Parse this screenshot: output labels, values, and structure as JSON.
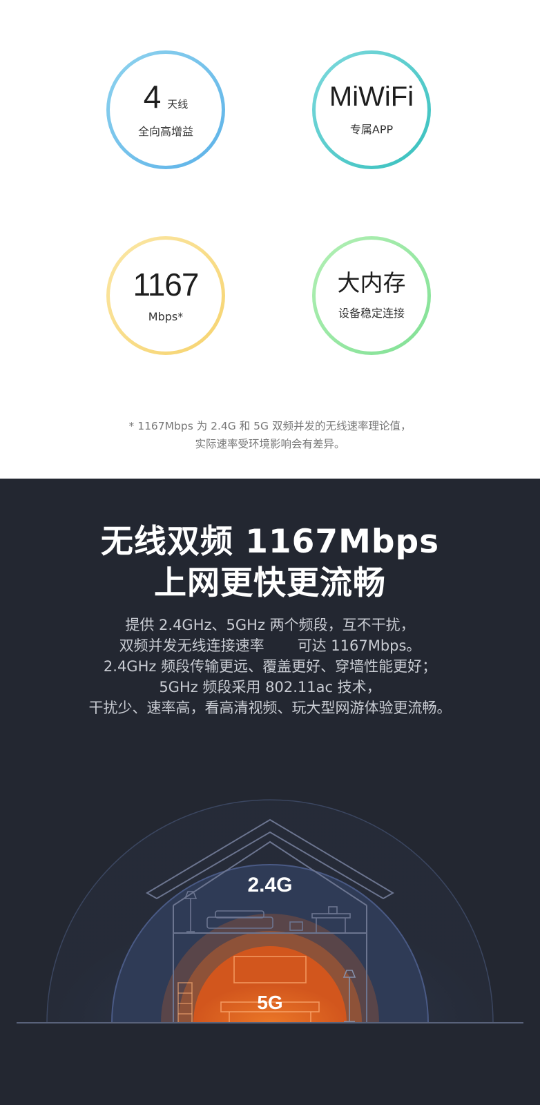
{
  "features": [
    {
      "main": "4",
      "unit": "天线",
      "sub": "全向高增益"
    },
    {
      "main": "MiWiFi",
      "sub": "专属APP"
    },
    {
      "main": "1167",
      "sub": "Mbps*"
    },
    {
      "main": "大内存",
      "sub": "设备稳定连接"
    }
  ],
  "footnote": {
    "line1": "* 1167Mbps 为 2.4G 和 5G 双频并发的无线速率理论值，",
    "line2": "实际速率受环境影响会有差异。"
  },
  "headline": {
    "line1": "无线双频 1167Mbps",
    "line2": "上网更快更流畅"
  },
  "description": {
    "line1": "提供 2.4GHz、5GHz 两个频段，互不干扰，",
    "line2a": "双频并发无线连接速率",
    "line2b": "可达 1167Mbps。",
    "line3": "2.4GHz 频段传输更远、覆盖更好、穿墙性能更好；",
    "line4": "5GHz 频段采用 802.11ac 技术，",
    "line5": "干扰少、速率高，看高清视频、玩大型网游体验更流畅。"
  },
  "bands": {
    "band_24": "2.4G",
    "band_5": "5G"
  },
  "colors": {
    "dark_bg": "#232731",
    "ring_blue": "#5bb1e8",
    "ring_teal": "#36c0bd",
    "ring_yellow": "#f6d36e",
    "ring_green": "#7fe094",
    "signal_orange": "#f26a1b"
  }
}
